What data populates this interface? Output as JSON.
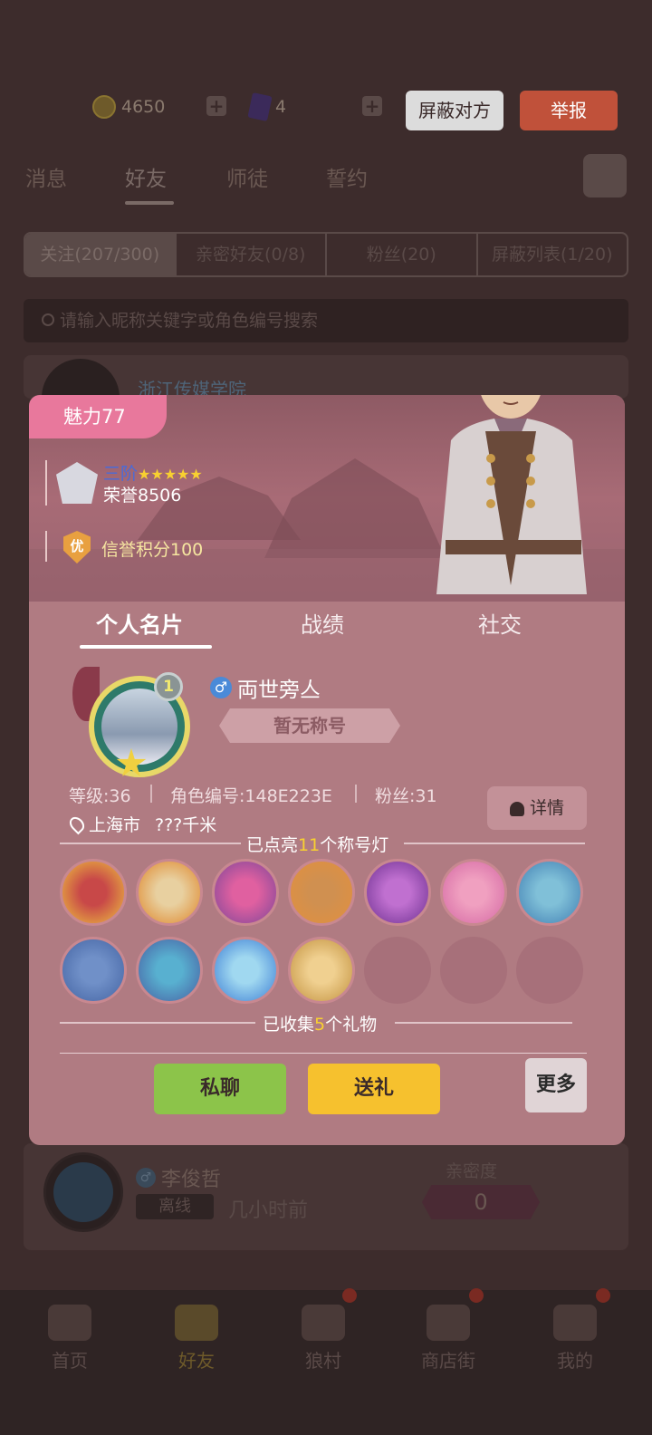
{
  "background": {
    "currency": {
      "gold": "4650",
      "cards": "4"
    },
    "header_buttons": {
      "block_label": "屏蔽对方",
      "report_label": "举报"
    },
    "nav_tabs": [
      "消息",
      "好友",
      "师徒",
      "誓约"
    ],
    "segments": [
      "关注(207/300)",
      "亲密好友(0/8)",
      "粉丝(20)",
      "屏蔽列表(1/20)"
    ],
    "search_placeholder": "请输入昵称关键字或角色编号搜索",
    "row1": {
      "school": "浙江传媒学院"
    },
    "row2": {
      "name": "李俊哲",
      "status": "离线",
      "last_seen": "几小时前",
      "intimacy_label": "亲密度",
      "intimacy": "0"
    },
    "bottom_nav": [
      "首页",
      "好友",
      "狼村",
      "商店街",
      "我的"
    ]
  },
  "profile": {
    "charm_label": "魅力",
    "charm_value": "77",
    "rank_name": "三阶",
    "rank_stars": "★★★★★",
    "honor": "荣誉8506",
    "credit_badge": "优",
    "credit": "信誉积分100",
    "tabs": [
      "个人名片",
      "战绩",
      "社交"
    ],
    "level_badge": "1",
    "gender_symbol": "♂",
    "nickname": "両世旁亼",
    "title_placeholder": "暂无称号",
    "level": "等级:36",
    "role_id": "角色编号:148E223E",
    "fans": "粉丝:31",
    "detail_label": "详情",
    "location": "上海市",
    "distance": "???千米",
    "lamps_prefix": "已点亮",
    "lamps_count": "11",
    "lamps_suffix": "个称号灯",
    "gifts_prefix": "已收集",
    "gifts_count": "5",
    "gifts_suffix": "个礼物",
    "buttons": {
      "chat": "私聊",
      "gift": "送礼",
      "more": "更多"
    }
  },
  "colors": {
    "chat_button": "#8cc44a",
    "gift_button": "#f6c12e",
    "charm_badge": "#e8789c",
    "popup_bg": "#b07b82",
    "report_button": "#c0513a"
  }
}
